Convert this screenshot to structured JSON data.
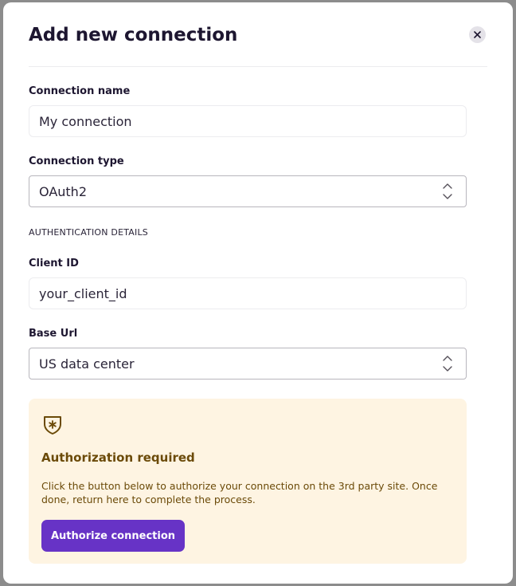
{
  "modal": {
    "title": "Add new connection",
    "close_icon": "close-icon"
  },
  "form": {
    "connection_name": {
      "label": "Connection name",
      "value": "My connection"
    },
    "connection_type": {
      "label": "Connection type",
      "selected": "OAuth2",
      "icon": "chevron-up-down-icon"
    },
    "auth_section_heading": "AUTHENTICATION DETAILS",
    "client_id": {
      "label": "Client ID",
      "value": "your_client_id"
    },
    "base_url": {
      "label": "Base Url",
      "selected": "US data center",
      "icon": "chevron-up-down-icon"
    }
  },
  "notice": {
    "icon": "shield-star-icon",
    "title": "Authorization required",
    "text": "Click the button below to authorize your connection on the 3rd party site. Once done, return here to complete the process.",
    "button_label": "Authorize connection"
  },
  "colors": {
    "accent": "#6733c6",
    "notice_background": "#fef4e2",
    "notice_text": "#6b4a08",
    "title_text": "#1d1630"
  }
}
